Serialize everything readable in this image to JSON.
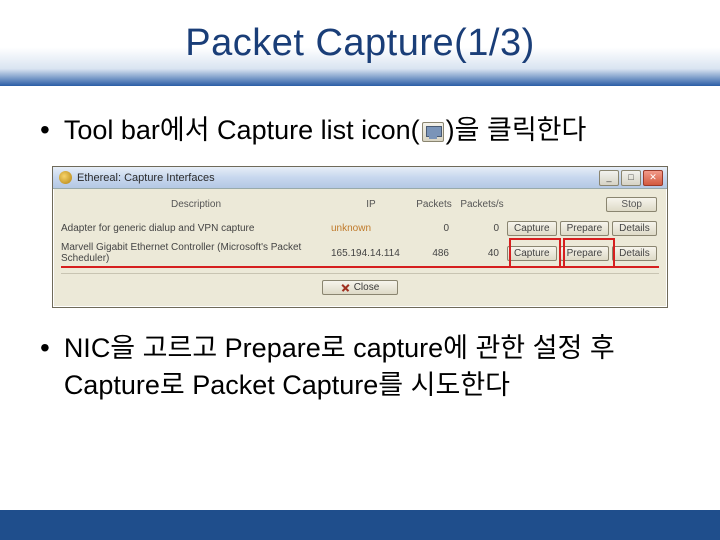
{
  "slide": {
    "title": "Packet Capture(1/3)",
    "bullet1_a": "Tool bar에서 Capture list icon(",
    "bullet1_b": ")을 클릭한다",
    "bullet2": "NIC을 고르고 Prepare로 capture에 관한 설정 후 Capture로 Packet Capture를 시도한다"
  },
  "dialog": {
    "window_title": "Ethereal: Capture Interfaces",
    "headers": {
      "description": "Description",
      "ip": "IP",
      "packets": "Packets",
      "pps": "Packets/s"
    },
    "stop_label": "Stop",
    "rows": [
      {
        "desc": "Adapter for generic dialup and VPN capture",
        "ip": "unknown",
        "packets": "0",
        "pps": "0",
        "capture": "Capture",
        "prepare": "Prepare",
        "details": "Details"
      },
      {
        "desc": "Marvell Gigabit Ethernet Controller (Microsoft's Packet Scheduler)",
        "ip": "165.194.14.114",
        "packets": "486",
        "pps": "40",
        "capture": "Capture",
        "prepare": "Prepare",
        "details": "Details"
      }
    ],
    "close_label": "Close"
  }
}
